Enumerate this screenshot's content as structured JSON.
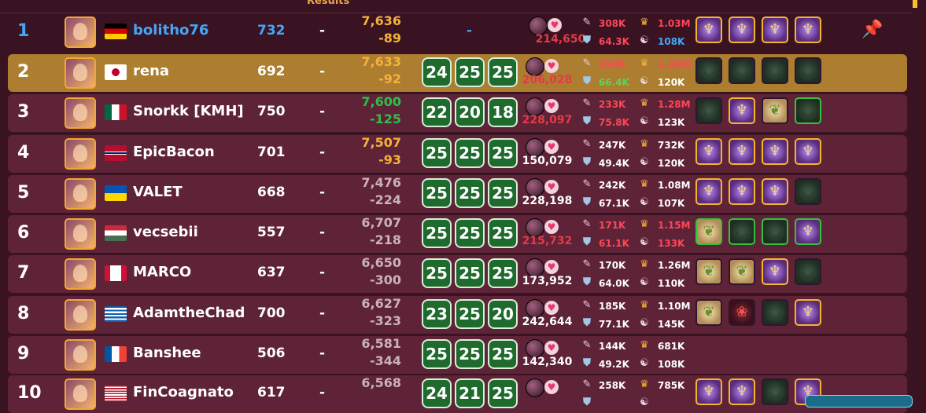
{
  "header": {
    "results_label": "Results",
    "sort_glyph": "ˇ"
  },
  "colors": {
    "bg": "#3a1322",
    "row": "#5f2337",
    "highlight": "#ad7d30",
    "accent_blue": "#44a7f5",
    "score_green": "#1f6b2d"
  },
  "rows": [
    {
      "rank": "1",
      "name": "bolitho76",
      "level": "732",
      "dash": "-",
      "pts_top": "7,636",
      "pts_bottom": "-89",
      "pts_color": "orange",
      "scores": [],
      "mid_dash": "-",
      "power": "214,650",
      "power_red": true,
      "attack": "308K",
      "defense": "64.3K",
      "ego": "1.03M",
      "harmony": "108K",
      "attack_red": true,
      "defense_red": true,
      "ego_red": true,
      "harmony_blue": true,
      "team": [
        "gold",
        "gold",
        "gold",
        "gold"
      ],
      "pin": true
    },
    {
      "rank": "2",
      "name": "rena",
      "level": "692",
      "dash": "-",
      "pts_top": "7,633",
      "pts_bottom": "-92",
      "pts_color": "orange",
      "scores": [
        "24",
        "25",
        "25"
      ],
      "power": "206,028",
      "power_red": true,
      "attack": "190K",
      "defense": "66.4K",
      "ego": "1.33M",
      "harmony": "120K",
      "attack_red": true,
      "defense_green": true,
      "ego_red": true,
      "team": [
        "bowl",
        "bowl",
        "bowl",
        "bowl"
      ]
    },
    {
      "rank": "3",
      "name": "Snorkk [KMH]",
      "level": "750",
      "dash": "-",
      "pts_top": "7,600",
      "pts_bottom": "-125",
      "pts_color": "green",
      "scores": [
        "22",
        "20",
        "18"
      ],
      "power": "228,097",
      "power_red": true,
      "attack": "233K",
      "defense": "75.8K",
      "ego": "1.28M",
      "harmony": "123K",
      "attack_red": true,
      "defense_red": true,
      "ego_red": true,
      "team": [
        "bowl",
        "gold",
        "leaf",
        "bowlgreen"
      ]
    },
    {
      "rank": "4",
      "name": "EpicBacon",
      "level": "701",
      "dash": "-",
      "pts_top": "7,507",
      "pts_bottom": "-93",
      "pts_color": "orange",
      "scores": [
        "25",
        "25",
        "25"
      ],
      "power": "150,079",
      "attack": "247K",
      "defense": "49.4K",
      "ego": "732K",
      "harmony": "120K",
      "team": [
        "gold",
        "gold",
        "gold",
        "gold"
      ]
    },
    {
      "rank": "5",
      "name": "VALET",
      "level": "668",
      "dash": "-",
      "pts_top": "7,476",
      "pts_bottom": "-224",
      "pts_color": "grey",
      "scores": [
        "25",
        "25",
        "25"
      ],
      "power": "228,198",
      "attack": "242K",
      "defense": "67.1K",
      "ego": "1.08M",
      "harmony": "107K",
      "team": [
        "gold",
        "gold",
        "gold",
        "bowl"
      ]
    },
    {
      "rank": "6",
      "name": "vecsebii",
      "level": "557",
      "dash": "-",
      "pts_top": "6,707",
      "pts_bottom": "-218",
      "pts_color": "grey",
      "scores": [
        "25",
        "25",
        "25"
      ],
      "power": "215,732",
      "power_red": true,
      "attack": "171K",
      "defense": "61.1K",
      "ego": "1.15M",
      "harmony": "133K",
      "attack_red": true,
      "defense_red": true,
      "ego_red": true,
      "harmony_red": true,
      "team": [
        "leafgreen",
        "bowlgreen",
        "bowlgreen",
        "goldgreen"
      ]
    },
    {
      "rank": "7",
      "name": "MARCO",
      "level": "637",
      "dash": "-",
      "pts_top": "6,650",
      "pts_bottom": "-300",
      "pts_color": "grey",
      "scores": [
        "25",
        "25",
        "25"
      ],
      "power": "173,952",
      "attack": "170K",
      "defense": "64.0K",
      "ego": "1.26M",
      "harmony": "110K",
      "team": [
        "leaf",
        "leaf",
        "gold",
        "bowl"
      ]
    },
    {
      "rank": "8",
      "name": "AdamtheChad",
      "level": "700",
      "dash": "-",
      "pts_top": "6,627",
      "pts_bottom": "-323",
      "pts_color": "grey",
      "scores": [
        "23",
        "25",
        "20"
      ],
      "power": "242,644",
      "attack": "185K",
      "defense": "77.1K",
      "ego": "1.10M",
      "harmony": "145K",
      "team": [
        "leaf",
        "berries",
        "bowl",
        "gold"
      ]
    },
    {
      "rank": "9",
      "name": "Banshee",
      "level": "506",
      "dash": "-",
      "pts_top": "6,581",
      "pts_bottom": "-344",
      "pts_color": "grey",
      "scores": [
        "25",
        "25",
        "25"
      ],
      "power": "142,340",
      "attack": "144K",
      "defense": "49.2K",
      "ego": "681K",
      "harmony": "108K",
      "team": []
    },
    {
      "rank": "10",
      "name": "FinCoagnato",
      "level": "617",
      "dash": "-",
      "pts_top": "6,568",
      "pts_bottom": "",
      "pts_color": "grey",
      "scores": [
        "24",
        "21",
        "25"
      ],
      "power": "",
      "attack": "258K",
      "defense": "",
      "ego": "785K",
      "harmony": "",
      "team": [
        "gold",
        "gold",
        "bowl",
        "gold"
      ]
    }
  ],
  "icons": {
    "pin": "pin-icon",
    "heart": "heart-icon",
    "attack": "attack-icon",
    "defense": "defense-icon",
    "ego": "ego-crown-icon",
    "harmony": "harmony-icon"
  }
}
